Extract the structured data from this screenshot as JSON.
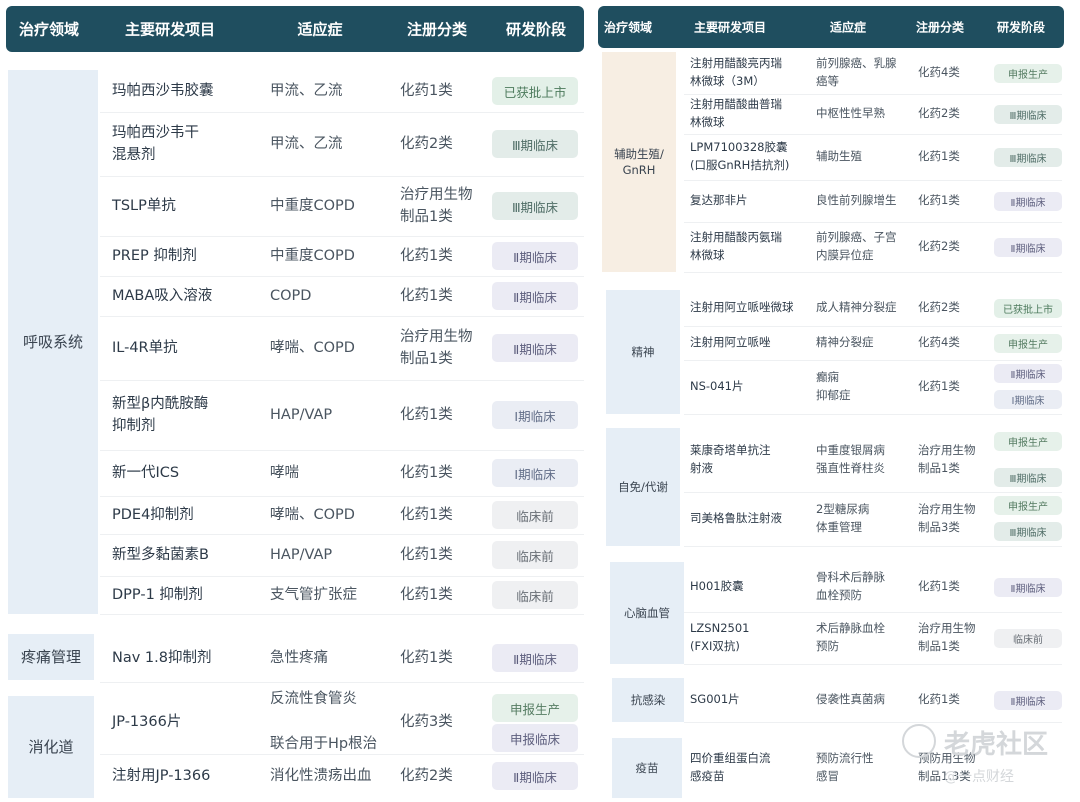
{
  "left": {
    "headers": [
      "治疗领域",
      "主要研发项目",
      "适应症",
      "注册分类",
      "研发阶段"
    ],
    "categories": [
      "呼吸系统",
      "疼痛管理",
      "消化道"
    ],
    "rows": [
      {
        "name": "玛帕西沙韦胶囊",
        "ind": "甲流、乙流",
        "cls": "化药1类",
        "stage": "已获批上市"
      },
      {
        "name": "玛帕西沙韦干\n混悬剂",
        "ind": "甲流、乙流",
        "cls": "化药2类",
        "stage": "Ⅲ期临床"
      },
      {
        "name": "TSLP单抗",
        "ind": "中重度COPD",
        "cls": "治疗用生物\n制品1类",
        "stage": "Ⅲ期临床"
      },
      {
        "name": "PREP 抑制剂",
        "ind": "中重度COPD",
        "cls": "化药1类",
        "stage": "Ⅱ期临床"
      },
      {
        "name": "MABA吸入溶液",
        "ind": "COPD",
        "cls": "化药1类",
        "stage": "Ⅱ期临床"
      },
      {
        "name": "IL-4R单抗",
        "ind": "哮喘、COPD",
        "cls": "治疗用生物\n制品1类",
        "stage": "Ⅱ期临床"
      },
      {
        "name": "新型β内酰胺酶\n抑制剂",
        "ind": "HAP/VAP",
        "cls": "化药1类",
        "stage": "Ⅰ期临床"
      },
      {
        "name": "新一代ICS",
        "ind": "哮喘",
        "cls": "化药1类",
        "stage": "Ⅰ期临床"
      },
      {
        "name": "PDE4抑制剂",
        "ind": "哮喘、COPD",
        "cls": "化药1类",
        "stage": "临床前"
      },
      {
        "name": "新型多黏菌素B",
        "ind": "HAP/VAP",
        "cls": "化药1类",
        "stage": "临床前"
      },
      {
        "name": "DPP-1 抑制剂",
        "ind": "支气管扩张症",
        "cls": "化药1类",
        "stage": "临床前"
      },
      {
        "name": "Nav 1.8抑制剂",
        "ind": "急性疼痛",
        "cls": "化药1类",
        "stage": "Ⅱ期临床"
      },
      {
        "name": "JP-1366片",
        "ind": "反流性食管炎\n\n联合用于Hp根治",
        "cls": "化药3类",
        "stage": "申报生产",
        "stage2": "申报临床"
      },
      {
        "name": "注射用JP-1366",
        "ind": "消化性溃疡出血",
        "cls": "化药2类",
        "stage": "Ⅱ期临床"
      }
    ]
  },
  "right": {
    "headers": [
      "治疗领域",
      "主要研发项目",
      "适应症",
      "注册分类",
      "研发阶段"
    ],
    "categories": [
      "辅助生殖/\nGnRH",
      "精神",
      "自免/代谢",
      "心脑血管",
      "抗感染",
      "疫苗"
    ],
    "rows": [
      {
        "name": "注射用醋酸亮丙瑞\n林微球（3M）",
        "ind": "前列腺癌、乳腺\n癌等",
        "cls": "化药4类",
        "stage": "申报生产"
      },
      {
        "name": "注射用醋酸曲普瑞\n林微球",
        "ind": "中枢性性早熟",
        "cls": "化药2类",
        "stage": "Ⅲ期临床"
      },
      {
        "name": "LPM7100328胶囊\n(口服GnRH拮抗剂)",
        "ind": "辅助生殖",
        "cls": "化药1类",
        "stage": "Ⅲ期临床"
      },
      {
        "name": "复达那非片",
        "ind": "良性前列腺增生",
        "cls": "化药1类",
        "stage": "Ⅱ期临床"
      },
      {
        "name": "注射用醋酸丙氨瑞\n林微球",
        "ind": "前列腺癌、子宫\n内膜异位症",
        "cls": "化药2类",
        "stage": "Ⅱ期临床"
      },
      {
        "name": "注射用阿立哌唑微球",
        "ind": "成人精神分裂症",
        "cls": "化药2类",
        "stage": "已获批上市"
      },
      {
        "name": "注射用阿立哌唑",
        "ind": "精神分裂症",
        "cls": "化药4类",
        "stage": "申报生产"
      },
      {
        "name": "NS-041片",
        "ind": "癫痫\n抑郁症",
        "cls": "化药1类",
        "stage": "Ⅱ期临床",
        "stage2": "Ⅰ期临床"
      },
      {
        "name": "莱康奇塔单抗注\n射液",
        "ind": "中重度银屑病\n强直性脊柱炎",
        "cls": "治疗用生物\n制品1类",
        "stage": "申报生产",
        "stage2": "Ⅲ期临床"
      },
      {
        "name": "司美格鲁肽注射液",
        "ind": "2型糖尿病\n体重管理",
        "cls": "治疗用生物\n制品3类",
        "stage": "申报生产",
        "stage2": "Ⅲ期临床"
      },
      {
        "name": "H001胶囊",
        "ind": "骨科术后静脉\n血栓预防",
        "cls": "化药1类",
        "stage": "Ⅱ期临床"
      },
      {
        "name": "LZSN2501\n(FXI双抗)",
        "ind": "术后静脉血栓\n预防",
        "cls": "治疗用生物\n制品1类",
        "stage": "临床前"
      },
      {
        "name": "SG001片",
        "ind": "侵袭性真菌病",
        "cls": "化药1类",
        "stage": "Ⅱ期临床"
      },
      {
        "name": "四价重组蛋白流\n感疫苗",
        "ind": "预防流行性\n感冒",
        "cls": "预防用生物\n制品1.3类",
        "stage": ""
      }
    ]
  },
  "watermark": {
    "brand": "老虎社区",
    "credit": "@一点财经"
  }
}
